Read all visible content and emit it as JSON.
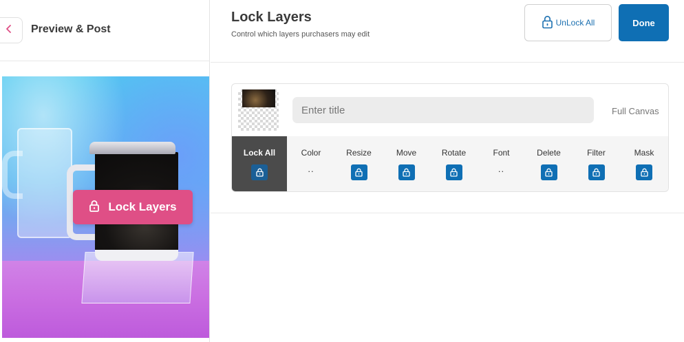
{
  "sidebar": {
    "title": "Preview & Post",
    "back_icon": "chevron-left-icon",
    "preview_button_label": "Lock Layers"
  },
  "header": {
    "title": "Lock Layers",
    "subtitle": "Control which layers purchasers may edit",
    "unlock_all_label": "UnLock All",
    "done_label": "Done"
  },
  "layer": {
    "title_value": "",
    "title_placeholder": "Enter title",
    "canvas_label": "Full Canvas",
    "permissions": [
      {
        "label": "Lock All",
        "control": "lock"
      },
      {
        "label": "Color",
        "control": "..",
        "dots": ".."
      },
      {
        "label": "Resize",
        "control": "lock"
      },
      {
        "label": "Move",
        "control": "lock"
      },
      {
        "label": "Rotate",
        "control": "lock"
      },
      {
        "label": "Font",
        "control": "..",
        "dots": ".."
      },
      {
        "label": "Delete",
        "control": "lock"
      },
      {
        "label": "Filter",
        "control": "lock"
      },
      {
        "label": "Mask",
        "control": "lock"
      }
    ]
  },
  "colors": {
    "accent_blue": "#0f6fb4",
    "pink": "#df4f86",
    "lockall_bg": "#4b4b4b"
  }
}
